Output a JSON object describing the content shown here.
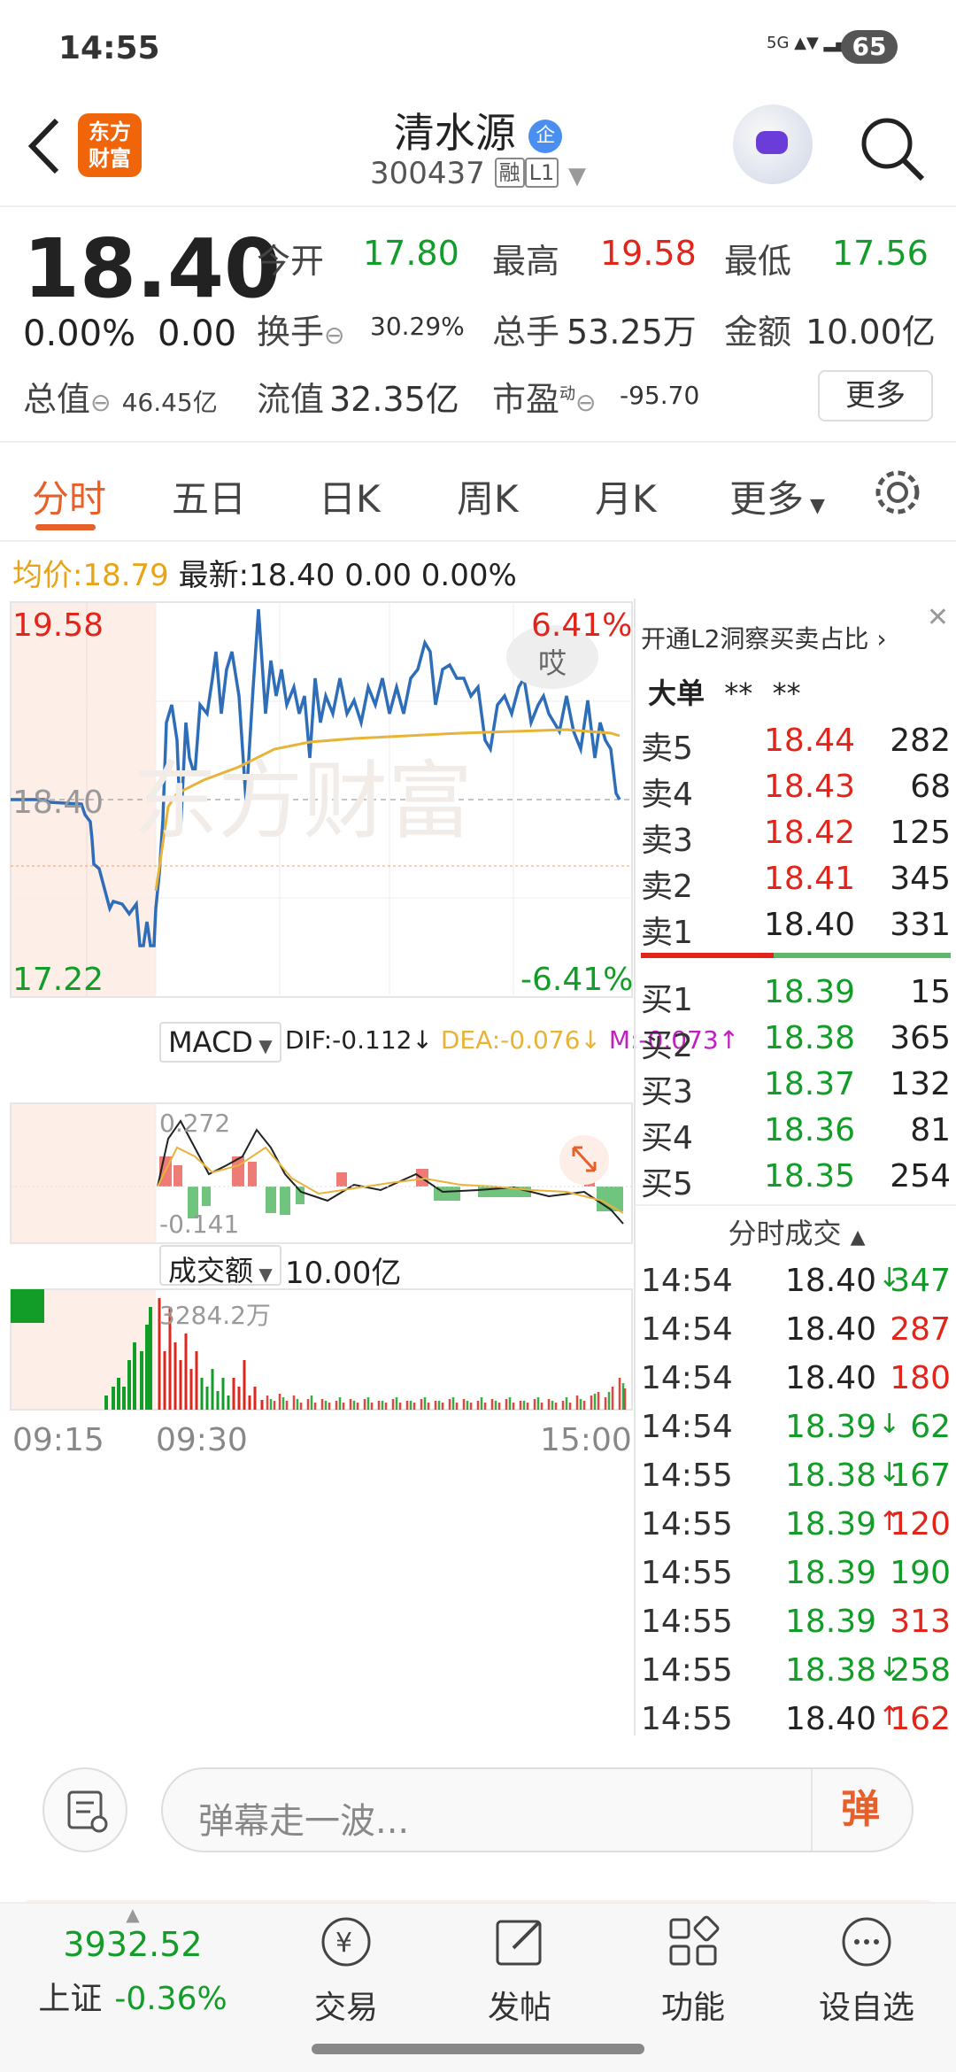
{
  "status_bar": {
    "time": "14:55",
    "network": "5G",
    "battery": "65"
  },
  "header": {
    "logo_text": "东方财富",
    "title": "清水源",
    "badge": "企",
    "code": "300437",
    "tags": [
      "融",
      "L1"
    ]
  },
  "quote": {
    "price": "18.40",
    "change_pct": "0.00%",
    "change": "0.00",
    "open_label": "今开",
    "open": "17.80",
    "high_label": "最高",
    "high": "19.58",
    "low_label": "最低",
    "low": "17.56",
    "turnover_label": "换手",
    "turnover": "30.29%",
    "volume_label": "总手",
    "volume": "53.25万",
    "amount_label": "金额",
    "amount": "10.00亿",
    "mktcap_label": "总值",
    "mktcap": "46.45亿",
    "float_label": "流值",
    "float_cap": "32.35亿",
    "pe_label": "市盈",
    "pe_sup": "动",
    "pe": "-95.70",
    "more_button": "更多"
  },
  "tabs": [
    "分时",
    "五日",
    "日K",
    "周K",
    "月K",
    "更多"
  ],
  "avg_row": {
    "avg_label": "均价:",
    "avg": "18.79",
    "latest_label": "最新:",
    "latest": "18.40",
    "chg": "0.00",
    "pct": "0.00%"
  },
  "chart": {
    "y_top": "19.58",
    "y_mid": "18.40",
    "y_bottom": "17.22",
    "pct_top": "6.41%",
    "pct_bottom": "-6.41%",
    "watermark": "东方财富",
    "bubble": "哎",
    "macd_label": "MACD",
    "dif": "DIF:-0.112",
    "dea": "DEA:-0.076",
    "m": "M:-0.073",
    "macd_top": "0.272",
    "macd_bottom": "-0.141",
    "vol_label": "成交额",
    "vol_total": "10.00亿",
    "vol_max": "3284.2万",
    "time_start": "09:15",
    "time_open": "09:30",
    "time_end": "15:00",
    "colors": {
      "price": "#2e6db8",
      "avg": "#e8b339",
      "up": "#e1251b",
      "down": "#129c28"
    }
  },
  "chart_data": {
    "type": "line",
    "x": [
      "09:15",
      "09:30",
      "15:00"
    ],
    "ylim": [
      17.22,
      19.58
    ],
    "series": []
  },
  "order_book": {
    "l2_link": "开通L2洞察买卖占比",
    "big_order_label": "大单",
    "big_order_vals": [
      "**",
      "**"
    ],
    "asks": [
      {
        "label": "卖5",
        "price": "18.44",
        "vol": "282"
      },
      {
        "label": "卖4",
        "price": "18.43",
        "vol": "68"
      },
      {
        "label": "卖3",
        "price": "18.42",
        "vol": "125"
      },
      {
        "label": "卖2",
        "price": "18.41",
        "vol": "345"
      },
      {
        "label": "卖1",
        "price": "18.40",
        "vol": "331"
      }
    ],
    "bids": [
      {
        "label": "买1",
        "price": "18.39",
        "vol": "15"
      },
      {
        "label": "买2",
        "price": "18.38",
        "vol": "365"
      },
      {
        "label": "买3",
        "price": "18.37",
        "vol": "132"
      },
      {
        "label": "买4",
        "price": "18.36",
        "vol": "81"
      },
      {
        "label": "买5",
        "price": "18.35",
        "vol": "254"
      }
    ],
    "trades_title": "分时成交",
    "trades": [
      {
        "time": "14:54",
        "price": "18.40",
        "arrow": "↓",
        "vol": "347",
        "pc": "#222",
        "ac": "#129c28",
        "vc": "#129c28"
      },
      {
        "time": "14:54",
        "price": "18.40",
        "arrow": "",
        "vol": "287",
        "pc": "#222",
        "ac": "#129c28",
        "vc": "#e1251b"
      },
      {
        "time": "14:54",
        "price": "18.40",
        "arrow": "",
        "vol": "180",
        "pc": "#222",
        "ac": "#129c28",
        "vc": "#e1251b"
      },
      {
        "time": "14:54",
        "price": "18.39",
        "arrow": "↓",
        "vol": "62",
        "pc": "#129c28",
        "ac": "#129c28",
        "vc": "#129c28"
      },
      {
        "time": "14:55",
        "price": "18.38",
        "arrow": "↓",
        "vol": "167",
        "pc": "#129c28",
        "ac": "#129c28",
        "vc": "#129c28"
      },
      {
        "time": "14:55",
        "price": "18.39",
        "arrow": "↑",
        "vol": "120",
        "pc": "#129c28",
        "ac": "#e1251b",
        "vc": "#e1251b"
      },
      {
        "time": "14:55",
        "price": "18.39",
        "arrow": "",
        "vol": "190",
        "pc": "#129c28",
        "ac": "#129c28",
        "vc": "#129c28"
      },
      {
        "time": "14:55",
        "price": "18.39",
        "arrow": "",
        "vol": "313",
        "pc": "#129c28",
        "ac": "#129c28",
        "vc": "#e1251b"
      },
      {
        "time": "14:55",
        "price": "18.38",
        "arrow": "↓",
        "vol": "258",
        "pc": "#129c28",
        "ac": "#129c28",
        "vc": "#129c28"
      },
      {
        "time": "14:55",
        "price": "18.40",
        "arrow": "↑",
        "vol": "162",
        "pc": "#222",
        "ac": "#e1251b",
        "vc": "#e1251b"
      }
    ]
  },
  "comment_bar": {
    "placeholder": "弹幕走一波...",
    "danmu_button": "弹"
  },
  "bottom_nav": {
    "index_value": "3932.52",
    "index_name": "上证",
    "index_pct": "-0.36%",
    "items": [
      "交易",
      "发帖",
      "功能",
      "设自选"
    ]
  }
}
